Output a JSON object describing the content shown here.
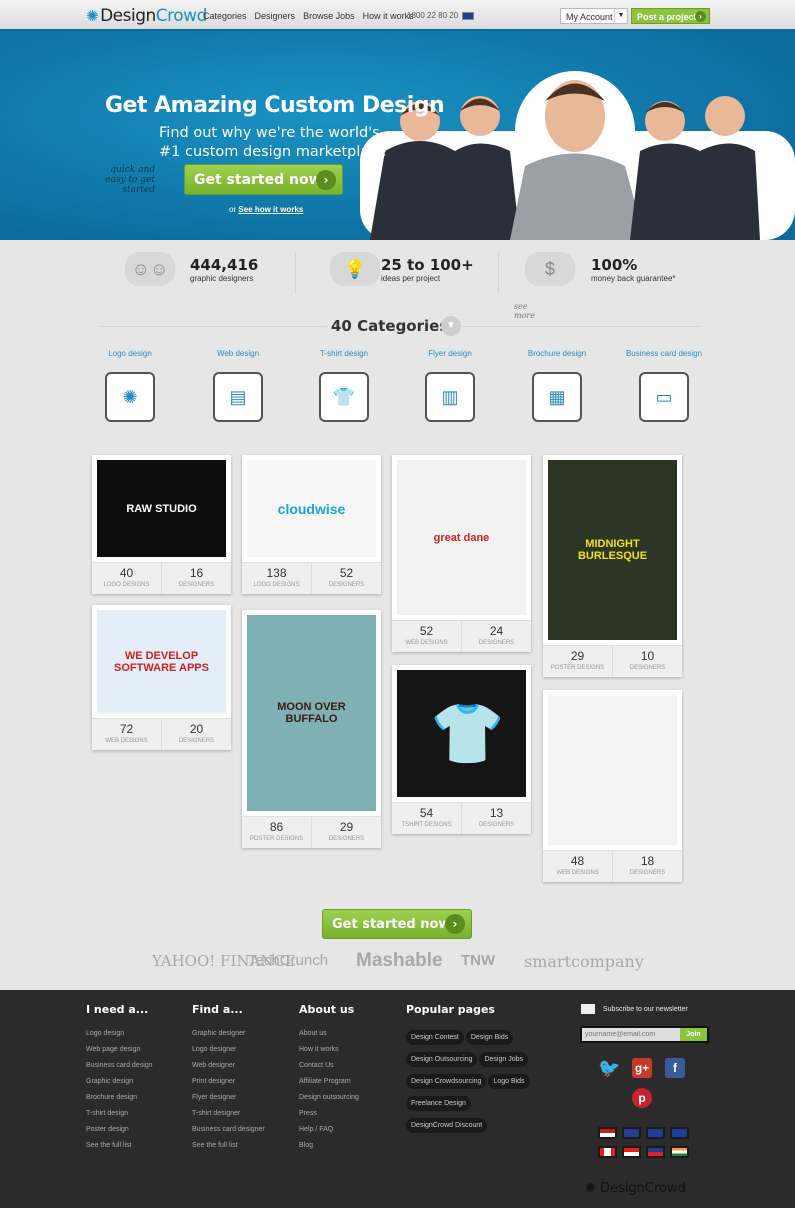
{
  "nav": {
    "brand_a": "Design",
    "brand_b": "Crowd",
    "links": [
      "Categories",
      "Designers",
      "Browse Jobs",
      "How it works"
    ],
    "phone": "1800 22 80 20",
    "account": "My Account",
    "post": "Post a project"
  },
  "hero": {
    "title": "Get Amazing Custom Design",
    "subtitle1": "Find out why we're the world's",
    "subtitle2": "#1 custom design marketplace",
    "note": "quick and easy to get started",
    "cta": "Get started now",
    "or": "or",
    "how": "See how it works"
  },
  "stats": [
    {
      "value": "444,416",
      "label": "graphic designers"
    },
    {
      "value": "25 to 100+",
      "label": "ideas per project"
    },
    {
      "value": "100%",
      "label": "money back guarantee*"
    }
  ],
  "categories": {
    "title": "40 Categories",
    "see_more": "see more",
    "items": [
      "Logo design",
      "Web design",
      "T-shirt design",
      "Flyer design",
      "Brochure design",
      "Business card design"
    ]
  },
  "gallery": [
    {
      "thumb": "RAW STUDIO",
      "bg": "#0c0c0c",
      "fg": "#ffffff",
      "count": "40",
      "type": "LOGO DESIGNS",
      "designers": "16"
    },
    {
      "thumb": "WE DEVELOP SOFTWARE APPS",
      "bg": "#e4eef8",
      "fg": "#cc2222",
      "count": "72",
      "type": "WEB DESIGNS",
      "designers": "20"
    },
    {
      "thumb": "cloudwise",
      "bg": "#f6f6f6",
      "fg": "#1aa3e0",
      "count": "138",
      "type": "LOGO DESIGNS",
      "designers": "52"
    },
    {
      "thumb": "MOON OVER BUFFALO",
      "bg": "#7fb0b5",
      "fg": "#3a1a10",
      "count": "86",
      "type": "POSTER DESIGNS",
      "designers": "29"
    },
    {
      "thumb": "great dane",
      "bg": "#f2f2f2",
      "fg": "#cc2222",
      "count": "52",
      "type": "WEB DESIGNS",
      "designers": "24"
    },
    {
      "thumb": "",
      "bg": "#151515",
      "fg": "#ffffff",
      "count": "54",
      "type": "TSHIRT DESIGNS",
      "designers": "13"
    },
    {
      "thumb": "MIDNIGHT BURLESQUE",
      "bg": "#2c3526",
      "fg": "#f2e21a",
      "count": "29",
      "type": "POSTER DESIGNS",
      "designers": "10"
    },
    {
      "thumb": "",
      "bg": "#f4f4f4",
      "fg": "#cc2222",
      "count": "48",
      "type": "WEB DESIGNS",
      "designers": "18"
    }
  ],
  "cta2": "Get started now",
  "press": [
    "YAHOO! FINANCE",
    "TechCrunch",
    "Mashable",
    "TNW",
    "smartcompany"
  ],
  "footer": {
    "cols": [
      {
        "title": "I need a...",
        "links": [
          "Logo design",
          "Web page design",
          "Business card design",
          "Graphic design",
          "Brochure design",
          "T-shirt design",
          "Poster design",
          "See the full list"
        ]
      },
      {
        "title": "Find a...",
        "links": [
          "Graphic designer",
          "Logo designer",
          "Web designer",
          "Print designer",
          "Flyer designer",
          "T-shirt designer",
          "Business card designer",
          "See the full list"
        ]
      },
      {
        "title": "About us",
        "links": [
          "About us",
          "How it works",
          "Contact Us",
          "Affiliate Program",
          "Design outsourcing",
          "Press",
          "Help / FAQ",
          "Blog"
        ]
      }
    ],
    "popular_title": "Popular pages",
    "popular": [
      "Design Contest",
      "Design Bids",
      "Design Outsourcing",
      "Design Jobs",
      "Design Crowdsourcing",
      "Logo Bids",
      "Freelance Design",
      "DesignCrowd Discount"
    ],
    "newsletter": "Subscribe to our newsletter",
    "email_placeholder": "yourname@email.com",
    "join": "Join",
    "social": [
      "twitter",
      "google-plus",
      "facebook",
      "pinterest"
    ],
    "flags": [
      "us",
      "uk",
      "australia",
      "new-zealand",
      "canada",
      "singapore",
      "philippines",
      "india"
    ],
    "brand": "DesignCrowd"
  }
}
